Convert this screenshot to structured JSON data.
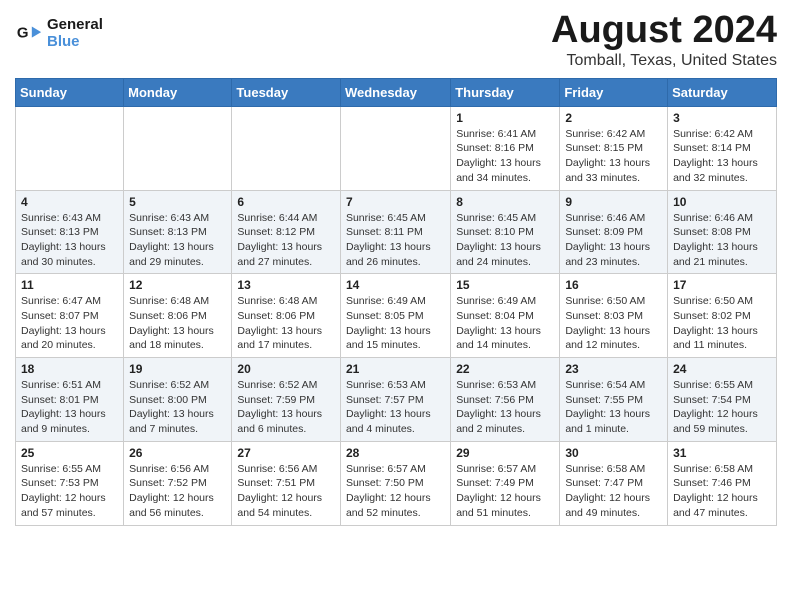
{
  "header": {
    "logo_line1": "General",
    "logo_line2": "Blue",
    "month_title": "August 2024",
    "location": "Tomball, Texas, United States"
  },
  "days_of_week": [
    "Sunday",
    "Monday",
    "Tuesday",
    "Wednesday",
    "Thursday",
    "Friday",
    "Saturday"
  ],
  "weeks": [
    [
      {
        "day": "",
        "info": ""
      },
      {
        "day": "",
        "info": ""
      },
      {
        "day": "",
        "info": ""
      },
      {
        "day": "",
        "info": ""
      },
      {
        "day": "1",
        "info": "Sunrise: 6:41 AM\nSunset: 8:16 PM\nDaylight: 13 hours\nand 34 minutes."
      },
      {
        "day": "2",
        "info": "Sunrise: 6:42 AM\nSunset: 8:15 PM\nDaylight: 13 hours\nand 33 minutes."
      },
      {
        "day": "3",
        "info": "Sunrise: 6:42 AM\nSunset: 8:14 PM\nDaylight: 13 hours\nand 32 minutes."
      }
    ],
    [
      {
        "day": "4",
        "info": "Sunrise: 6:43 AM\nSunset: 8:13 PM\nDaylight: 13 hours\nand 30 minutes."
      },
      {
        "day": "5",
        "info": "Sunrise: 6:43 AM\nSunset: 8:13 PM\nDaylight: 13 hours\nand 29 minutes."
      },
      {
        "day": "6",
        "info": "Sunrise: 6:44 AM\nSunset: 8:12 PM\nDaylight: 13 hours\nand 27 minutes."
      },
      {
        "day": "7",
        "info": "Sunrise: 6:45 AM\nSunset: 8:11 PM\nDaylight: 13 hours\nand 26 minutes."
      },
      {
        "day": "8",
        "info": "Sunrise: 6:45 AM\nSunset: 8:10 PM\nDaylight: 13 hours\nand 24 minutes."
      },
      {
        "day": "9",
        "info": "Sunrise: 6:46 AM\nSunset: 8:09 PM\nDaylight: 13 hours\nand 23 minutes."
      },
      {
        "day": "10",
        "info": "Sunrise: 6:46 AM\nSunset: 8:08 PM\nDaylight: 13 hours\nand 21 minutes."
      }
    ],
    [
      {
        "day": "11",
        "info": "Sunrise: 6:47 AM\nSunset: 8:07 PM\nDaylight: 13 hours\nand 20 minutes."
      },
      {
        "day": "12",
        "info": "Sunrise: 6:48 AM\nSunset: 8:06 PM\nDaylight: 13 hours\nand 18 minutes."
      },
      {
        "day": "13",
        "info": "Sunrise: 6:48 AM\nSunset: 8:06 PM\nDaylight: 13 hours\nand 17 minutes."
      },
      {
        "day": "14",
        "info": "Sunrise: 6:49 AM\nSunset: 8:05 PM\nDaylight: 13 hours\nand 15 minutes."
      },
      {
        "day": "15",
        "info": "Sunrise: 6:49 AM\nSunset: 8:04 PM\nDaylight: 13 hours\nand 14 minutes."
      },
      {
        "day": "16",
        "info": "Sunrise: 6:50 AM\nSunset: 8:03 PM\nDaylight: 13 hours\nand 12 minutes."
      },
      {
        "day": "17",
        "info": "Sunrise: 6:50 AM\nSunset: 8:02 PM\nDaylight: 13 hours\nand 11 minutes."
      }
    ],
    [
      {
        "day": "18",
        "info": "Sunrise: 6:51 AM\nSunset: 8:01 PM\nDaylight: 13 hours\nand 9 minutes."
      },
      {
        "day": "19",
        "info": "Sunrise: 6:52 AM\nSunset: 8:00 PM\nDaylight: 13 hours\nand 7 minutes."
      },
      {
        "day": "20",
        "info": "Sunrise: 6:52 AM\nSunset: 7:59 PM\nDaylight: 13 hours\nand 6 minutes."
      },
      {
        "day": "21",
        "info": "Sunrise: 6:53 AM\nSunset: 7:57 PM\nDaylight: 13 hours\nand 4 minutes."
      },
      {
        "day": "22",
        "info": "Sunrise: 6:53 AM\nSunset: 7:56 PM\nDaylight: 13 hours\nand 2 minutes."
      },
      {
        "day": "23",
        "info": "Sunrise: 6:54 AM\nSunset: 7:55 PM\nDaylight: 13 hours\nand 1 minute."
      },
      {
        "day": "24",
        "info": "Sunrise: 6:55 AM\nSunset: 7:54 PM\nDaylight: 12 hours\nand 59 minutes."
      }
    ],
    [
      {
        "day": "25",
        "info": "Sunrise: 6:55 AM\nSunset: 7:53 PM\nDaylight: 12 hours\nand 57 minutes."
      },
      {
        "day": "26",
        "info": "Sunrise: 6:56 AM\nSunset: 7:52 PM\nDaylight: 12 hours\nand 56 minutes."
      },
      {
        "day": "27",
        "info": "Sunrise: 6:56 AM\nSunset: 7:51 PM\nDaylight: 12 hours\nand 54 minutes."
      },
      {
        "day": "28",
        "info": "Sunrise: 6:57 AM\nSunset: 7:50 PM\nDaylight: 12 hours\nand 52 minutes."
      },
      {
        "day": "29",
        "info": "Sunrise: 6:57 AM\nSunset: 7:49 PM\nDaylight: 12 hours\nand 51 minutes."
      },
      {
        "day": "30",
        "info": "Sunrise: 6:58 AM\nSunset: 7:47 PM\nDaylight: 12 hours\nand 49 minutes."
      },
      {
        "day": "31",
        "info": "Sunrise: 6:58 AM\nSunset: 7:46 PM\nDaylight: 12 hours\nand 47 minutes."
      }
    ]
  ]
}
